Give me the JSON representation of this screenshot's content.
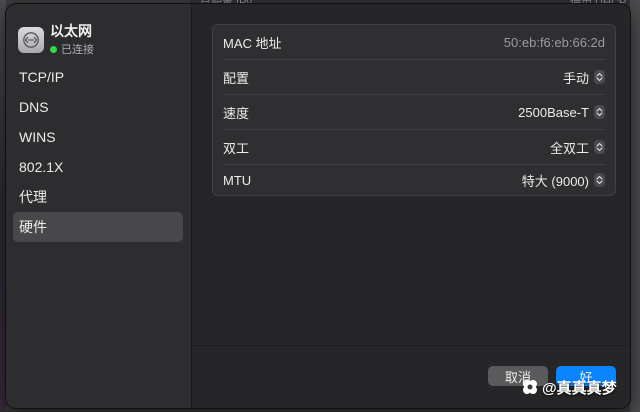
{
  "background": {
    "partial_text_left": "已配置 IPv",
    "partial_text_right": "使用 DHCP"
  },
  "sidebar": {
    "title": "以太网",
    "status": "已连接",
    "items": [
      {
        "label": "TCP/IP",
        "active": false
      },
      {
        "label": "DNS",
        "active": false
      },
      {
        "label": "WINS",
        "active": false
      },
      {
        "label": "802.1X",
        "active": false
      },
      {
        "label": "代理",
        "active": false
      },
      {
        "label": "硬件",
        "active": true
      }
    ]
  },
  "hardware": {
    "rows": [
      {
        "label": "MAC 地址",
        "value": "50:eb:f6:eb:66:2d",
        "stepper": false
      },
      {
        "label": "配置",
        "value": "手动",
        "stepper": true
      },
      {
        "label": "速度",
        "value": "2500Base-T",
        "stepper": true
      },
      {
        "label": "双工",
        "value": "全双工",
        "stepper": true
      },
      {
        "label": "MTU",
        "value": "特大 (9000)",
        "stepper": true
      }
    ]
  },
  "buttons": {
    "cancel": "取消",
    "ok": "好"
  },
  "watermark": "@真真真梦",
  "colors": {
    "accent": "#0a84ff",
    "status_green": "#32d74b"
  }
}
